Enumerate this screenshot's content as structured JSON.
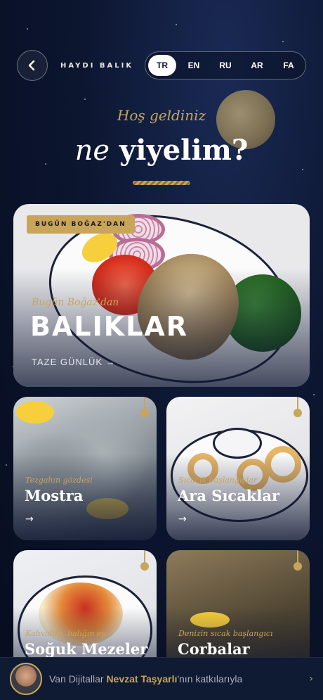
{
  "header": {
    "brand": "HAYDI BALIK",
    "back_icon": "chevron-left-icon",
    "languages": [
      {
        "code": "TR",
        "active": true
      },
      {
        "code": "EN",
        "active": false
      },
      {
        "code": "RU",
        "active": false
      },
      {
        "code": "AR",
        "active": false
      },
      {
        "code": "FA",
        "active": false
      }
    ]
  },
  "hero": {
    "welcome": "Hoş geldiniz",
    "headline_italic": "ne",
    "headline_bold": "yiyelim?"
  },
  "featured": {
    "badge": "BUGÜN BOĞAZ'DAN",
    "subtitle": "Bugün Boğaz'dan",
    "title": "BALIKLAR",
    "cta": "TAZE GÜNLÜK →"
  },
  "categories": [
    {
      "subtitle": "Tezgahın gözdesi",
      "title": "Mostra",
      "arrow": "→"
    },
    {
      "subtitle": "Sıcacık başlangıçlar",
      "title": "Ara Sıcaklar",
      "arrow": "→"
    },
    {
      "subtitle": "Kahvaltılı, balığın eş…",
      "title": "Soğuk Mezeler",
      "arrow": "→"
    },
    {
      "subtitle": "Denizin sıcak başlangıcı",
      "title": "Corbalar",
      "arrow": "→"
    }
  ],
  "footer": {
    "text_lead": "Van Dijitallar",
    "text_name": "Nevzat Taşyarlı",
    "text_tail": "'nın katkılarıyla",
    "chevron_icon": "chevron-right-icon"
  },
  "colors": {
    "gold": "#c9a55a",
    "navy": "#0c1630",
    "white": "#ffffff"
  }
}
